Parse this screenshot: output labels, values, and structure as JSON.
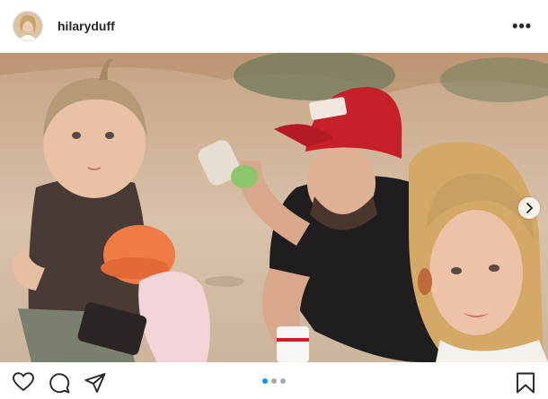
{
  "post": {
    "username": "hilaryduff",
    "more_glyph": "•••",
    "carousel": {
      "total": 3,
      "active_index": 0
    }
  },
  "icons": {
    "header": [
      "avatar",
      "more-options-icon"
    ],
    "photo": [
      "carousel-next-icon"
    ],
    "actions": [
      "heart-icon",
      "comment-icon",
      "share-icon",
      "bookmark-icon"
    ]
  },
  "colors": {
    "text": "#262626",
    "active_dot": "#0095f6",
    "inactive_dot": "#a8a8a8",
    "cap": "#c8202a"
  }
}
